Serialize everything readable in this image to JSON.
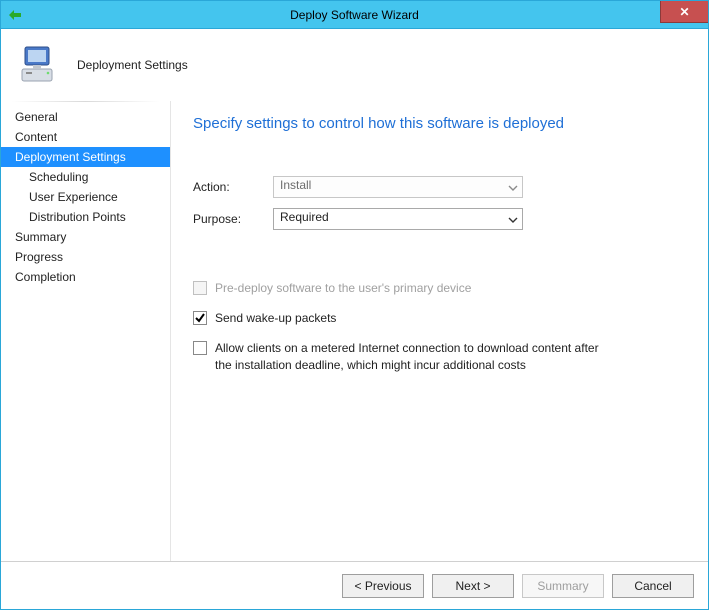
{
  "window": {
    "title": "Deploy Software Wizard",
    "close_glyph": "✕"
  },
  "header": {
    "subtitle": "Deployment Settings"
  },
  "sidebar": {
    "items": [
      {
        "label": "General",
        "selected": false,
        "sub": false
      },
      {
        "label": "Content",
        "selected": false,
        "sub": false
      },
      {
        "label": "Deployment Settings",
        "selected": true,
        "sub": false
      },
      {
        "label": "Scheduling",
        "selected": false,
        "sub": true
      },
      {
        "label": "User Experience",
        "selected": false,
        "sub": true
      },
      {
        "label": "Distribution Points",
        "selected": false,
        "sub": true
      },
      {
        "label": "Summary",
        "selected": false,
        "sub": false
      },
      {
        "label": "Progress",
        "selected": false,
        "sub": false
      },
      {
        "label": "Completion",
        "selected": false,
        "sub": false
      }
    ]
  },
  "content": {
    "heading": "Specify settings to control how this software is deployed",
    "action_label": "Action:",
    "action_value": "Install",
    "purpose_label": "Purpose:",
    "purpose_value": "Required",
    "opt_predeploy": "Pre-deploy software to the user's primary device",
    "opt_wakeup": "Send wake-up packets",
    "opt_metered": "Allow clients on a metered Internet connection to download content after the installation deadline, which might incur additional costs"
  },
  "footer": {
    "previous": "< Previous",
    "next": "Next >",
    "summary": "Summary",
    "cancel": "Cancel"
  }
}
